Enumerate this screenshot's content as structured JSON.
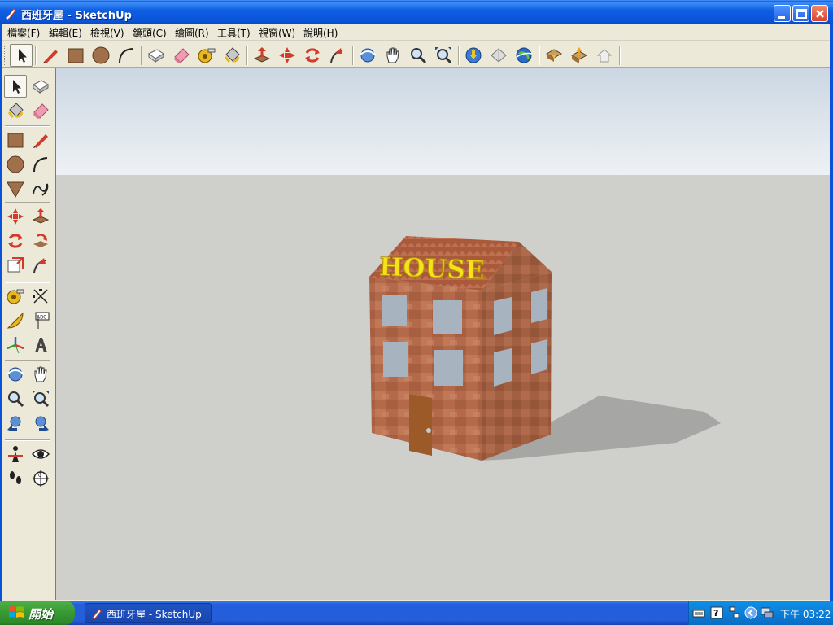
{
  "window": {
    "title": "西班牙屋 - SketchUp"
  },
  "menu": [
    {
      "label": "檔案(F)"
    },
    {
      "label": "編輯(E)"
    },
    {
      "label": "檢視(V)"
    },
    {
      "label": "鏡頭(C)"
    },
    {
      "label": "繪圖(R)"
    },
    {
      "label": "工具(T)"
    },
    {
      "label": "視窗(W)"
    },
    {
      "label": "說明(H)"
    }
  ],
  "toolbar": {
    "tools": [
      "select-icon",
      "pencil-icon",
      "rectangle-icon",
      "circle-icon",
      "arc-icon",
      "make-component-icon",
      "eraser-icon",
      "tape-measure-icon",
      "paint-bucket-icon",
      "push-pull-icon",
      "move-icon",
      "rotate-icon",
      "follow-me-icon",
      "orbit-icon",
      "pan-icon",
      "zoom-icon",
      "zoom-extents-icon",
      "get-models-icon",
      "share-model-icon",
      "google-earth-icon",
      "get-current-view-icon",
      "place-model-icon",
      "snapshot-icon"
    ]
  },
  "scene": {
    "sign_text": "HOUSE",
    "sign_color": "#f5e21a",
    "brick_color": "#b46a4a",
    "window_color": "#a7b4bf",
    "shadow_color": "#a6a6a4"
  },
  "taskbar": {
    "start_label": "開始",
    "task_label": "西班牙屋 - SketchUp",
    "clock": "下午 03:22"
  }
}
